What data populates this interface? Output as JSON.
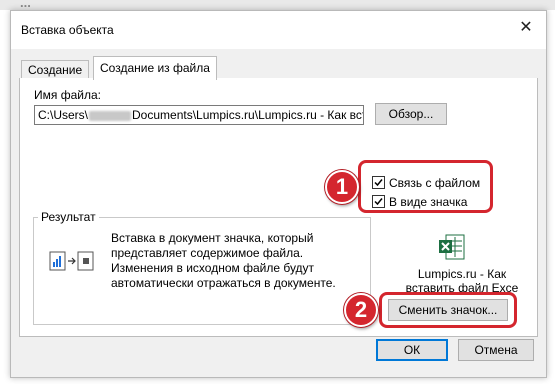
{
  "background": {
    "partial_text": "..."
  },
  "dialog": {
    "title": "Вставка объекта",
    "close_symbol": "✕",
    "tabs": [
      {
        "label": "Создание",
        "active": false
      },
      {
        "label": "Создание из файла",
        "active": true
      }
    ],
    "filename_label": "Имя файла:",
    "filename_value_start": "C:\\Users\\",
    "filename_value_end": "Documents\\Lumpics.ru\\Lumpics.ru - Как вставит",
    "browse_button": "Обзор...",
    "link_checkbox": {
      "label": "Связь с файлом",
      "checked": true
    },
    "icon_checkbox": {
      "label": "В виде значка",
      "checked": true
    },
    "result_label": "Результат",
    "result_lines": [
      "Вставка в документ значка, который",
      "представляет содержимое файла.",
      "Изменения в исходном файле будут",
      "автоматически отражаться в документе."
    ],
    "icon_caption_line1": "Lumpics.ru - Как",
    "icon_caption_line2": "вставить файл Exce",
    "change_icon_button": "Сменить значок...",
    "ok_button": "ОК",
    "cancel_button": "Отмена"
  },
  "annotations": {
    "badge1": "1",
    "badge2": "2",
    "accent_color": "#d4262e"
  },
  "colors": {
    "excel_green": "#1d6f42",
    "focus_blue": "#0078d7"
  }
}
